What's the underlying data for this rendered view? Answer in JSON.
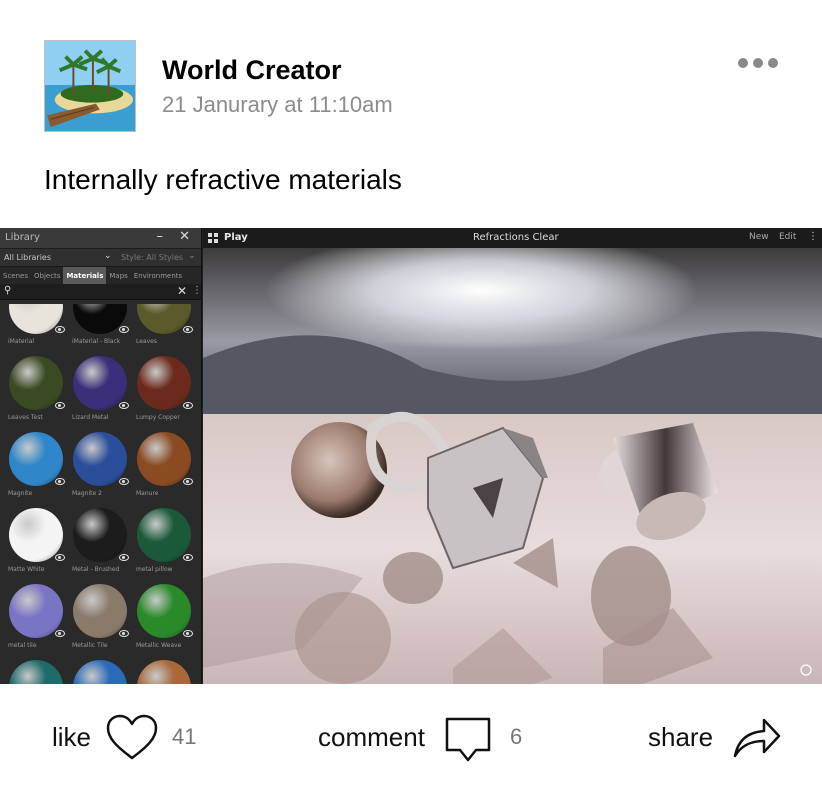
{
  "post": {
    "author": "World Creator",
    "timestamp": "21 Janurary at 11:10am",
    "text": "Internally refractive materials",
    "avatar_icon": "island-avatar",
    "more_icon": "more-dots-icon"
  },
  "app": {
    "library": {
      "title": "Library",
      "window_controls": "– ✕",
      "filter": "All Libraries",
      "style": "Style: All Styles",
      "tabs": [
        "Scenes",
        "Objects",
        "Materials",
        "Maps",
        "Environments"
      ],
      "active_tab": "Materials",
      "materials": [
        {
          "label": "iMaterial",
          "color": "#e8e4dc"
        },
        {
          "label": "iMaterial - Black",
          "color": "#0a0a0a"
        },
        {
          "label": "Leaves",
          "color": "#5a5a2a"
        },
        {
          "label": "Leaves Test",
          "color": "#3b4a22"
        },
        {
          "label": "Lizard Metal",
          "color": "#3a2f78"
        },
        {
          "label": "Lumpy Copper",
          "color": "#6b2a1c"
        },
        {
          "label": "Magnite",
          "color": "#2f86c8"
        },
        {
          "label": "Magnite 2",
          "color": "#2a4e9a"
        },
        {
          "label": "Manure",
          "color": "#8a4a22"
        },
        {
          "label": "Matte White",
          "color": "#f4f4f4"
        },
        {
          "label": "Metal - Brushed",
          "color": "#1c1c1c"
        },
        {
          "label": "metal pillow",
          "color": "#1a5a3a"
        },
        {
          "label": "metal tile",
          "color": "#7a74c4"
        },
        {
          "label": "Metallic Tile",
          "color": "#8a7a6a"
        },
        {
          "label": "Metallic Weave",
          "color": "#2a8a2a"
        },
        {
          "label": "",
          "color": "#1f6a6a"
        },
        {
          "label": "",
          "color": "#2a6ab8"
        },
        {
          "label": "",
          "color": "#a8683a"
        }
      ]
    },
    "viewport": {
      "play_label": "Play",
      "title": "Refractions Clear",
      "new_label": "New",
      "edit_label": "Edit",
      "kebab": "⋮"
    }
  },
  "actions": {
    "like_label": "like",
    "like_count": "41",
    "comment_label": "comment",
    "comment_count": "6",
    "share_label": "share"
  }
}
